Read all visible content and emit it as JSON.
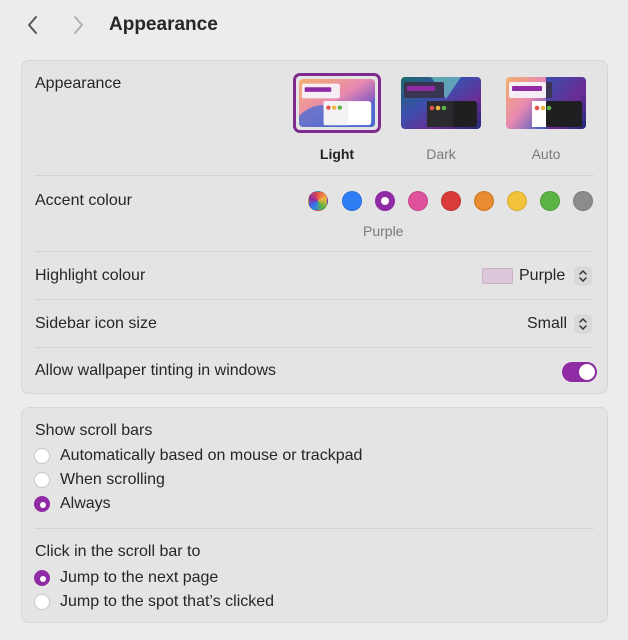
{
  "header": {
    "title": "Appearance",
    "back_icon": "chevron-left-icon",
    "forward_icon": "chevron-right-icon"
  },
  "appearance": {
    "label": "Appearance",
    "options": [
      {
        "label": "Light",
        "selected": true
      },
      {
        "label": "Dark",
        "selected": false
      },
      {
        "label": "Auto",
        "selected": false
      }
    ]
  },
  "accent": {
    "label": "Accent colour",
    "selected_name": "Purple",
    "colors": [
      "multicolor",
      "#2f7ef6",
      "#8f2ba4",
      "#e0519b",
      "#d93a3a",
      "#e88b33",
      "#f2c33a",
      "#5bb344",
      "#8c8c8c"
    ]
  },
  "highlight": {
    "label": "Highlight colour",
    "value": "Purple",
    "color": "#dcc6da"
  },
  "sidebar_icon": {
    "label": "Sidebar icon size",
    "value": "Small"
  },
  "tinting": {
    "label": "Allow wallpaper tinting in windows",
    "on": true
  },
  "scrollbars": {
    "label": "Show scroll bars",
    "options": [
      {
        "label": "Automatically based on mouse or trackpad",
        "selected": false
      },
      {
        "label": "When scrolling",
        "selected": false
      },
      {
        "label": "Always",
        "selected": true
      }
    ]
  },
  "click_scroll": {
    "label": "Click in the scroll bar to",
    "options": [
      {
        "label": "Jump to the next page",
        "selected": true
      },
      {
        "label": "Jump to the spot that’s clicked",
        "selected": false
      }
    ]
  }
}
